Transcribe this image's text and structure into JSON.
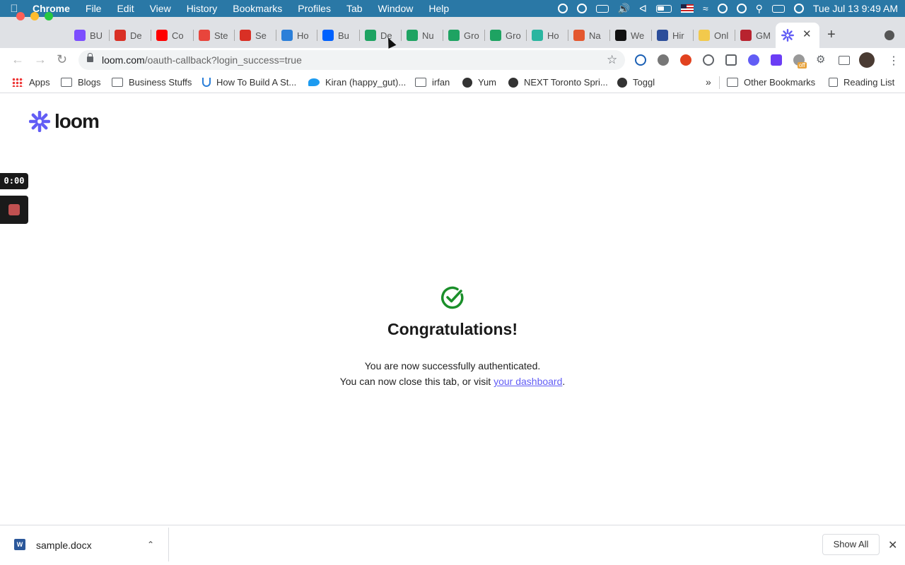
{
  "menubar": {
    "app": "Chrome",
    "items": [
      "File",
      "Edit",
      "View",
      "History",
      "Bookmarks",
      "Profiles",
      "Tab",
      "Window",
      "Help"
    ],
    "datetime": "Tue Jul 13  9:49 AM"
  },
  "tabs": [
    {
      "label": "BU",
      "icon": "waveform-icon",
      "color": "#7c4dff"
    },
    {
      "label": "De",
      "icon": "gmail-icon",
      "color": "#d93025"
    },
    {
      "label": "Co",
      "icon": "youtube-icon",
      "color": "#ff0000"
    },
    {
      "label": "Ste",
      "icon": "app-icon",
      "color": "#e8453c"
    },
    {
      "label": "Se",
      "icon": "gmail-icon",
      "color": "#d93025"
    },
    {
      "label": "Ho",
      "icon": "u-icon",
      "color": "#2b7fd9"
    },
    {
      "label": "Bu",
      "icon": "dropbox-icon",
      "color": "#0061fe"
    },
    {
      "label": "De",
      "icon": "sheets-icon",
      "color": "#1ea362"
    },
    {
      "label": "Nu",
      "icon": "sheets-icon",
      "color": "#1ea362"
    },
    {
      "label": "Gro",
      "icon": "sheets-icon",
      "color": "#1ea362"
    },
    {
      "label": "Gro",
      "icon": "sheets-icon",
      "color": "#1ea362"
    },
    {
      "label": "Ho",
      "icon": "leaf-icon",
      "color": "#2ab5a0"
    },
    {
      "label": "Na",
      "icon": "wave-icon",
      "color": "#e4572e"
    },
    {
      "label": "We",
      "icon": "wwd-icon",
      "color": "#111111"
    },
    {
      "label": "Hir",
      "icon": "compass-icon",
      "color": "#2b4d9a"
    },
    {
      "label": "Onl",
      "icon": "sparkle-icon",
      "color": "#f2c94c"
    },
    {
      "label": "GM",
      "icon": "home-icon",
      "color": "#b8232f"
    }
  ],
  "active_tab": {
    "icon": "loom-icon",
    "color": "#625df5"
  },
  "address_bar": {
    "host": "loom.com",
    "path": "/oauth-callback?login_success=true"
  },
  "bookmarks": [
    {
      "label": "Apps",
      "icon": "apps-grid-icon"
    },
    {
      "label": "Blogs",
      "icon": "folder-icon"
    },
    {
      "label": "Business Stuffs",
      "icon": "folder-icon"
    },
    {
      "label": "How To Build A St...",
      "icon": "u-icon"
    },
    {
      "label": "Kiran (happy_gut)...",
      "icon": "twitter-icon"
    },
    {
      "label": "irfan",
      "icon": "folder-icon"
    },
    {
      "label": "Yum",
      "icon": "globe-icon"
    },
    {
      "label": "NEXT Toronto Spri...",
      "icon": "globe-icon"
    },
    {
      "label": "Toggl",
      "icon": "globe-icon"
    }
  ],
  "other_bookmarks": "Other Bookmarks",
  "reading_list": "Reading List",
  "extension_badge": "off",
  "page": {
    "brand": "loom",
    "brand_color": "#625df5",
    "recorder_timer": "0:00",
    "heading": "Congratulations!",
    "line1": "You are now successfully authenticated.",
    "line2_prefix": "You can now close this tab, or visit ",
    "line2_link": "your dashboard",
    "line2_suffix": ".",
    "success_color": "#1a8f2a"
  },
  "downloads": {
    "file_name": "sample.docx",
    "file_icon_letter": "W",
    "show_all": "Show All"
  }
}
